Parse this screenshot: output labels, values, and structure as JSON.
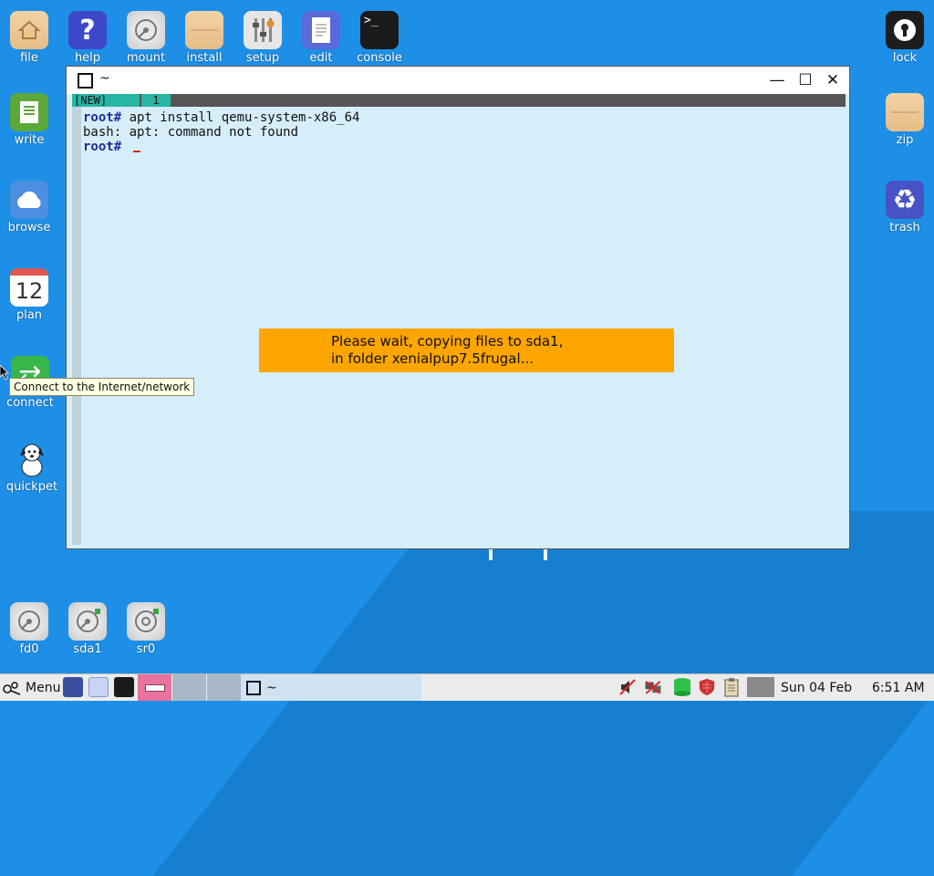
{
  "desktop": {
    "icons_top": [
      {
        "label": "file",
        "icon": "home-folder-icon"
      },
      {
        "label": "help",
        "icon": "help-icon"
      },
      {
        "label": "mount",
        "icon": "drive-icon"
      },
      {
        "label": "install",
        "icon": "package-icon"
      },
      {
        "label": "setup",
        "icon": "settings-icon"
      },
      {
        "label": "edit",
        "icon": "text-editor-icon"
      },
      {
        "label": "console",
        "icon": "terminal-icon"
      }
    ],
    "icons_left": [
      {
        "label": "write",
        "icon": "word-processor-icon"
      },
      {
        "label": "browse",
        "icon": "cloud-browser-icon"
      },
      {
        "label": "plan",
        "icon": "calendar-icon",
        "glyph": "12"
      },
      {
        "label": "connect",
        "icon": "network-connect-icon"
      },
      {
        "label": "quickpet",
        "icon": "puppy-dog-icon"
      }
    ],
    "icons_right": [
      {
        "label": "lock",
        "icon": "lock-icon"
      },
      {
        "label": "zip",
        "icon": "archive-icon"
      },
      {
        "label": "trash",
        "icon": "recycle-icon"
      }
    ],
    "drives": [
      {
        "label": "fd0",
        "icon": "floppy-drive-icon"
      },
      {
        "label": "sda1",
        "icon": "hard-drive-icon"
      },
      {
        "label": "sr0",
        "icon": "optical-drive-icon"
      }
    ],
    "tooltip": "Connect to the Internet/network"
  },
  "window": {
    "title": "~",
    "controls": {
      "minimize": "—",
      "maximize": "☐",
      "close": "✕"
    },
    "tmux": {
      "status": "[NEW]",
      "window_index": "1"
    },
    "terminal_lines": [
      {
        "prompt": "root#",
        "text": " apt install qemu-system-x86_64"
      },
      {
        "prompt": "",
        "text": "bash: apt: command not found"
      },
      {
        "prompt": "root#",
        "text": " "
      }
    ]
  },
  "message": {
    "line1": "Please wait, copying files to sda1,",
    "line2": "in folder xenialpup7.5frugal..."
  },
  "taskbar": {
    "menu_label": "Menu",
    "task_title": "~",
    "date": "Sun 04 Feb",
    "time": "6:51 AM"
  },
  "colors": {
    "desktop_bg": "#1e8fe6",
    "terminal_bg": "#d6eefa",
    "message_bg": "#ffa500",
    "tmux_accent": "#27b6a3"
  }
}
